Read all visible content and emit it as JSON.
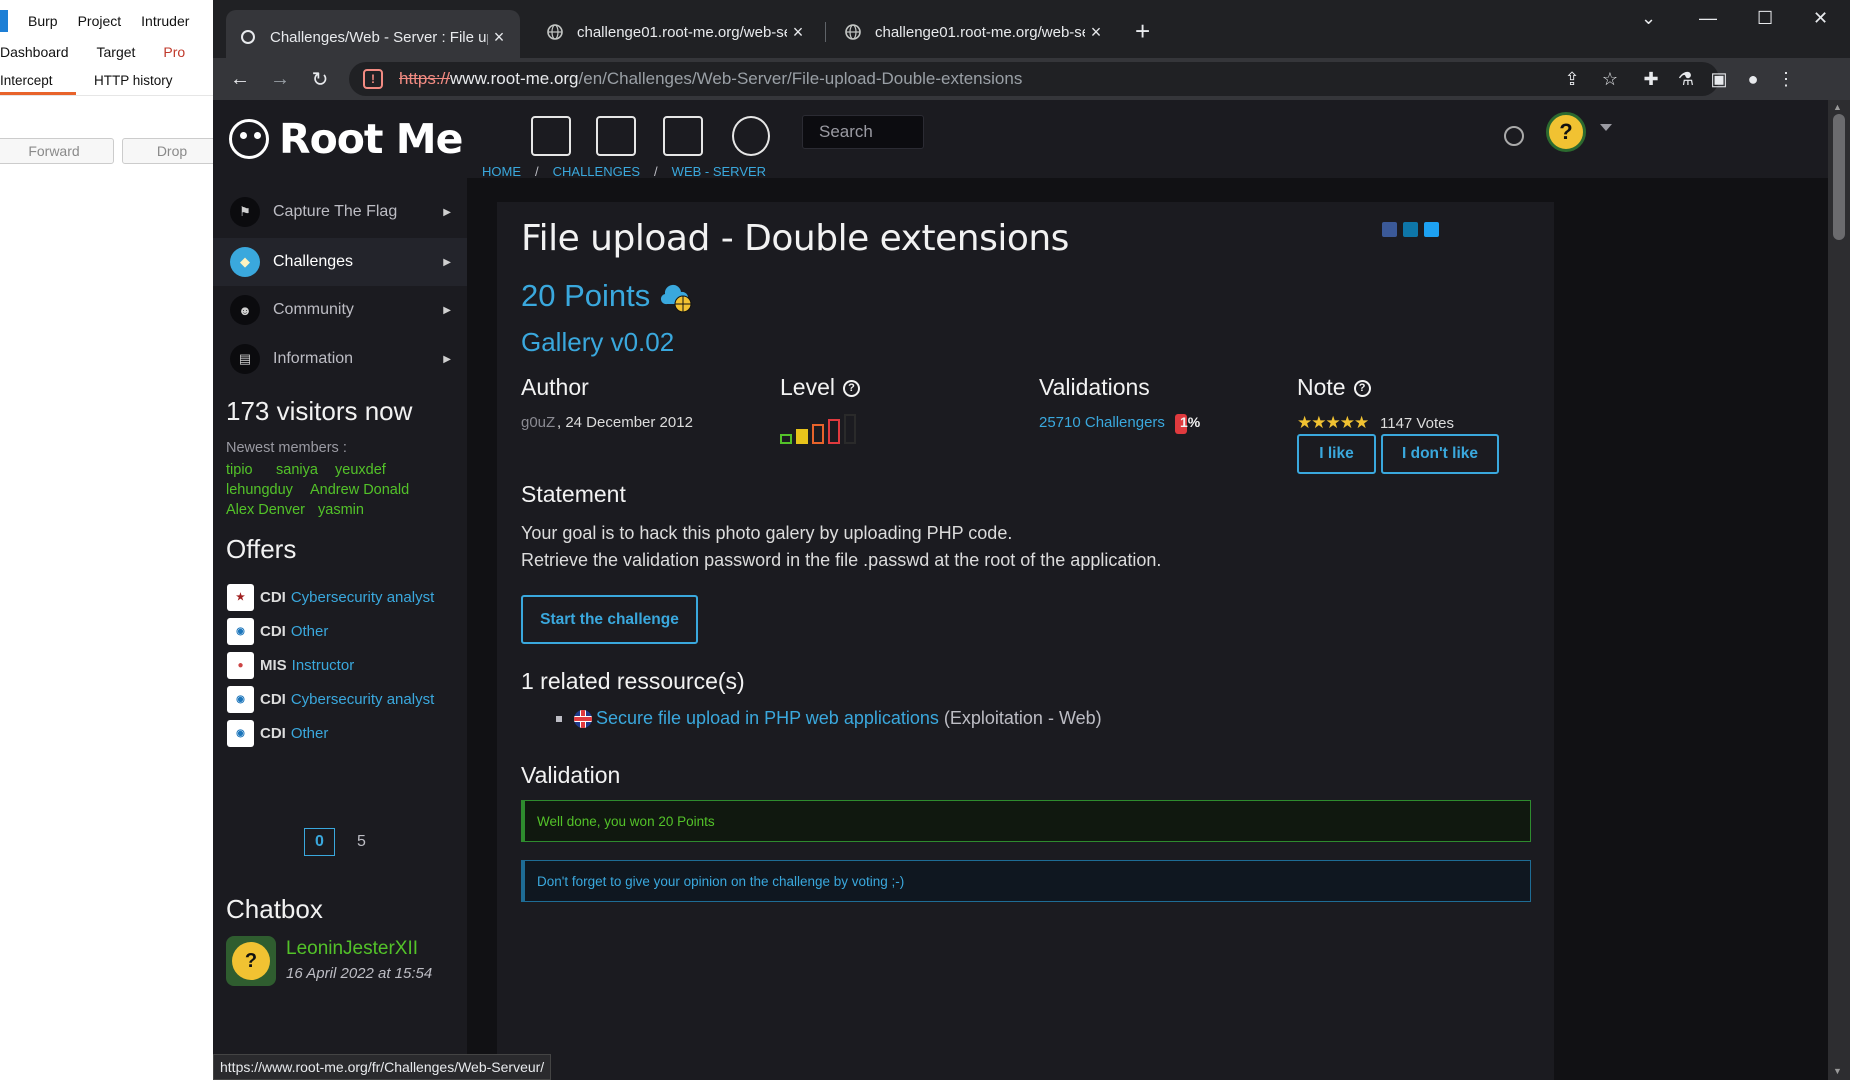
{
  "burp": {
    "menu": [
      "Burp",
      "Project",
      "Intruder"
    ],
    "tabs_top": [
      "Dashboard",
      "Target",
      "Pro"
    ],
    "tabs_sub": [
      "Intercept",
      "HTTP history"
    ],
    "buttons": [
      "Forward",
      "Drop"
    ]
  },
  "browser": {
    "tabs": [
      {
        "title": "Challenges/Web - Server : File up",
        "close": "×"
      },
      {
        "title": "challenge01.root-me.org/web-se",
        "close": "×"
      },
      {
        "title": "challenge01.root-me.org/web-se",
        "close": "×"
      }
    ],
    "new_tab": "+",
    "url_scheme": "https://",
    "url_host": "www.root-me.org",
    "url_path": "/en/Challenges/Web-Server/File-upload-Double-extensions",
    "status_url": "https://www.root-me.org/fr/Challenges/Web-Serveur/"
  },
  "site": {
    "logo": "Root Me",
    "search_placeholder": "Search",
    "sidebar": {
      "items": [
        {
          "label": "Capture The Flag"
        },
        {
          "label": "Challenges"
        },
        {
          "label": "Community"
        },
        {
          "label": "Information"
        }
      ],
      "visitors": "173 visitors now",
      "newest_label": "Newest members :",
      "members": [
        "tipio",
        "saniya",
        "yeuxdef",
        "lehungduy",
        "Andrew Donald",
        "Alex Denver",
        "yasmin"
      ],
      "offers_title": "Offers",
      "offers": [
        {
          "kind": "CDI",
          "role": "Cybersecurity analyst"
        },
        {
          "kind": "CDI",
          "role": "Other"
        },
        {
          "kind": "MIS",
          "role": "Instructor"
        },
        {
          "kind": "CDI",
          "role": "Cybersecurity analyst"
        },
        {
          "kind": "CDI",
          "role": "Other"
        }
      ],
      "pager": {
        "current": "0",
        "next": "5"
      },
      "chatbox_title": "Chatbox",
      "chat": {
        "user": "LeoninJesterXII",
        "time": "16 April 2022 at 15:54"
      }
    },
    "breadcrumb": [
      "HOME",
      "CHALLENGES",
      "WEB - SERVER"
    ],
    "breadcrumb_sep": "/",
    "challenge": {
      "title": "File upload - Double extensions",
      "points": "20 Points",
      "subtitle": "Gallery v0.02",
      "author_h": "Author",
      "author": "g0uZ",
      "date": ", 24 December 2012",
      "level_h": "Level",
      "level_value": 2,
      "level_max": 5,
      "validations_h": "Validations",
      "validations": "25710 Challengers",
      "validation_pct": "1%",
      "note_h": "Note",
      "stars": "★★★★★",
      "rating": 5,
      "votes": "1147 Votes",
      "like": "I like",
      "dislike": "I don't like",
      "statement_h": "Statement",
      "statement_1": "Your goal is to hack this photo galery by uploading PHP code.",
      "statement_2": "Retrieve the validation password in the file .passwd at the root of the application.",
      "start": "Start the challenge",
      "related_h": "1 related ressource(s)",
      "resource_link": "Secure file upload in PHP web applications",
      "resource_cat": "(Exploitation - Web)",
      "validation_h": "Validation",
      "msg_ok": "Well done, you won 20 Points",
      "msg_info": "Don't forget to give your opinion on the challenge by voting ;-)"
    }
  },
  "colors": {
    "accent": "#3aa8dd",
    "green": "#53c229",
    "bg": "#111114",
    "panel": "#1b1b20"
  }
}
